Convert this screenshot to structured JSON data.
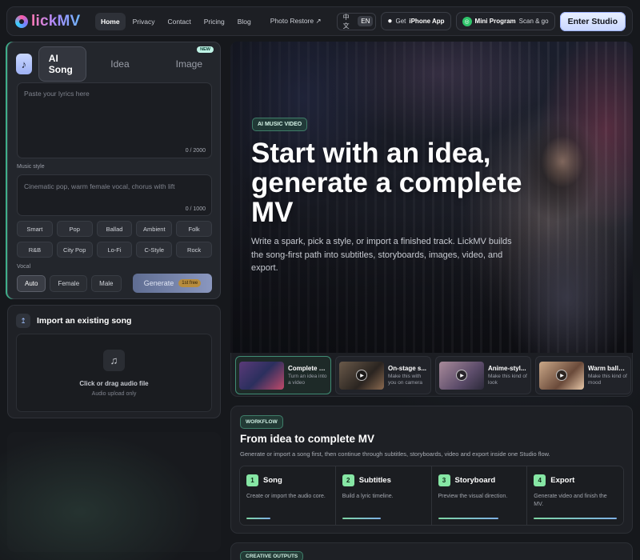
{
  "brand": {
    "name": "lickMV"
  },
  "nav": {
    "links": [
      "Home",
      "Privacy",
      "Contact",
      "Pricing",
      "Blog"
    ],
    "photo_restore": "Photo Restore ↗",
    "lang_zh": "中文",
    "lang_en": "EN",
    "iphone_prefix": "Get",
    "iphone_bold": "iPhone App",
    "mini_bold": "Mini Program",
    "mini_suffix": "Scan & go",
    "enter": "Enter Studio"
  },
  "composer": {
    "tabs": [
      "AI Song",
      "Idea",
      "Image"
    ],
    "new_badge": "NEW",
    "lyrics_placeholder": "Paste your lyrics here",
    "lyrics_counter": "0 / 2000",
    "style_label": "Music style",
    "style_placeholder": "Cinematic pop, warm female vocal, chorus with lift",
    "style_counter": "0 / 1000",
    "chips": [
      "Smart",
      "Pop",
      "Ballad",
      "Ambient",
      "Folk",
      "R&B",
      "City Pop",
      "Lo-Fi",
      "C-Style",
      "Rock"
    ],
    "vocal_label": "Vocal",
    "vocal_options": [
      "Auto",
      "Female",
      "Male"
    ],
    "generate": "Generate",
    "free_tag": "1st free"
  },
  "import": {
    "title": "Import an existing song",
    "drop_title": "Click or drag audio file",
    "drop_sub": "Audio upload only"
  },
  "hero": {
    "badge": "AI MUSIC VIDEO",
    "title": "Start with an idea, generate a complete MV",
    "description": "Write a spark, pick a style, or import a finished track. LickMV builds the song-first path into subtitles, storyboards, images, video, and export."
  },
  "thumbs": [
    {
      "title": "Complete MV",
      "sub": "Turn an idea into a video"
    },
    {
      "title": "On-stage s...",
      "sub": "Make this with you on camera"
    },
    {
      "title": "Anime-styl...",
      "sub": "Make this kind of look"
    },
    {
      "title": "Warm balla...",
      "sub": "Make this kind of mood"
    }
  ],
  "workflow": {
    "badge": "WORKFLOW",
    "title": "From idea to complete MV",
    "description": "Generate or import a song first, then continue through subtitles, storyboards, video and export inside one Studio flow.",
    "steps": [
      {
        "num": "1",
        "title": "Song",
        "desc": "Create or import the audio core."
      },
      {
        "num": "2",
        "title": "Subtitles",
        "desc": "Build a lyric timeline."
      },
      {
        "num": "3",
        "title": "Storyboard",
        "desc": "Preview the visual direction."
      },
      {
        "num": "4",
        "title": "Export",
        "desc": "Generate video and finish the MV."
      }
    ]
  },
  "creative": {
    "badge": "CREATIVE OUTPUTS"
  }
}
